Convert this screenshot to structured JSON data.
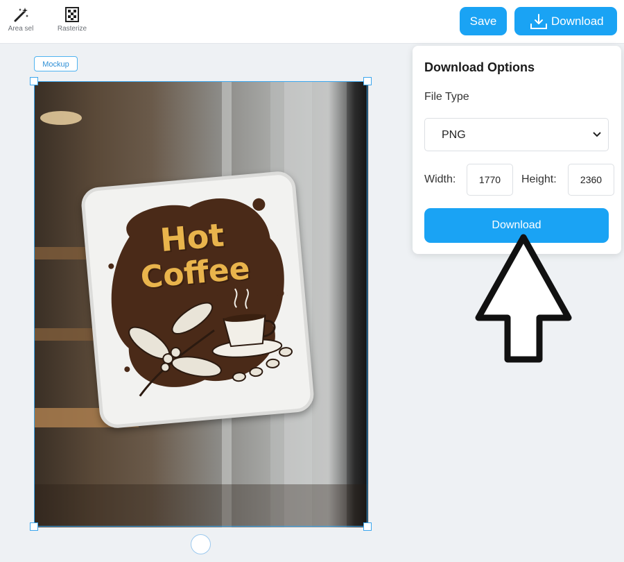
{
  "toolbar": {
    "tools": [
      {
        "label": "Area sel",
        "icon": "magic-wand-icon"
      },
      {
        "label": "Rasterize",
        "icon": "rasterize-icon"
      }
    ],
    "save_label": "Save",
    "download_label": "Download"
  },
  "canvas": {
    "mockup_tag": "Mockup",
    "sticker": {
      "line1": "Hot",
      "line2": "Coffee"
    }
  },
  "download_panel": {
    "title": "Download Options",
    "file_type_label": "File Type",
    "file_type_value": "PNG",
    "width_label": "Width:",
    "width_value": "1770",
    "height_label": "Height:",
    "height_value": "2360",
    "download_button": "Download"
  },
  "colors": {
    "accent": "#1aa3f4",
    "selection": "#3aa6ee",
    "sticker_text": "#e9b44c",
    "sticker_ink": "#4a2a18"
  }
}
